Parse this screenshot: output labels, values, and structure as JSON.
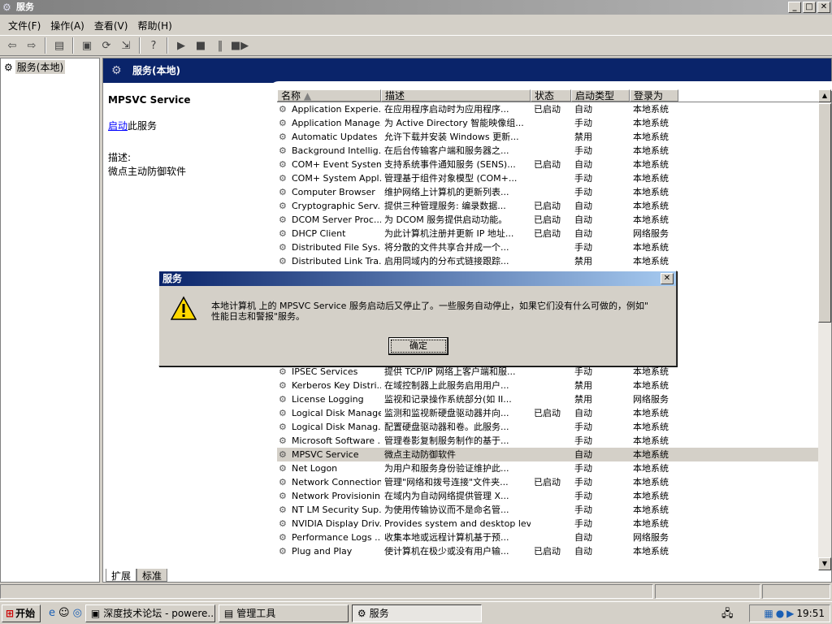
{
  "window": {
    "title": "服务"
  },
  "menu": [
    "文件(F)",
    "操作(A)",
    "查看(V)",
    "帮助(H)"
  ],
  "tree": {
    "root": "服务(本地)"
  },
  "pane": {
    "header": "服务(本地)",
    "selected_service": "MPSVC Service",
    "action_link": "启动",
    "action_suffix": "此服务",
    "desc_label": "描述:",
    "desc_text": "微点主动防御软件"
  },
  "columns": [
    "名称",
    "描述",
    "状态",
    "启动类型",
    "登录为"
  ],
  "rows_top": [
    [
      "Application Experie...",
      "在应用程序启动时为应用程序...",
      "已启动",
      "自动",
      "本地系统"
    ],
    [
      "Application Manage...",
      "为 Active Directory 智能映像组...",
      "",
      "手动",
      "本地系统"
    ],
    [
      "Automatic Updates",
      "允许下载并安装 Windows 更新...",
      "",
      "禁用",
      "本地系统"
    ],
    [
      "Background Intellig...",
      "在后台传输客户端和服务器之...",
      "",
      "手动",
      "本地系统"
    ],
    [
      "COM+ Event System",
      "支持系统事件通知服务 (SENS)...",
      "已启动",
      "自动",
      "本地系统"
    ],
    [
      "COM+ System Appl...",
      "管理基于组件对象模型 (COM+...",
      "",
      "手动",
      "本地系统"
    ],
    [
      "Computer Browser",
      "维护网络上计算机的更新列表...",
      "",
      "手动",
      "本地系统"
    ],
    [
      "Cryptographic Serv...",
      "提供三种管理服务: 编录数据...",
      "已启动",
      "自动",
      "本地系统"
    ],
    [
      "DCOM Server Proc...",
      "为 DCOM 服务提供启动功能。",
      "已启动",
      "自动",
      "本地系统"
    ],
    [
      "DHCP Client",
      "为此计算机注册并更新 IP 地址...",
      "已启动",
      "自动",
      "网络服务"
    ],
    [
      "Distributed File Sys...",
      "将分散的文件共享合并成一个...",
      "",
      "手动",
      "本地系统"
    ],
    [
      "Distributed Link Tra...",
      "启用同域内的分布式链接跟踪...",
      "",
      "禁用",
      "本地系统"
    ]
  ],
  "rows_bottom": [
    [
      "Intersite Messaging",
      "启用在运行 Windows Server 的...",
      "",
      "禁用",
      "本地系统"
    ],
    [
      "IPSEC Services",
      "提供 TCP/IP 网络上客户端和服...",
      "",
      "手动",
      "本地系统"
    ],
    [
      "Kerberos Key Distri...",
      "在域控制器上此服务启用用户...",
      "",
      "禁用",
      "本地系统"
    ],
    [
      "License Logging",
      "监视和记录操作系统部分(如 II...",
      "",
      "禁用",
      "网络服务"
    ],
    [
      "Logical Disk Manager",
      "监测和监视新硬盘驱动器并向...",
      "已启动",
      "自动",
      "本地系统"
    ],
    [
      "Logical Disk Manag...",
      "配置硬盘驱动器和卷。此服务...",
      "",
      "手动",
      "本地系统"
    ],
    [
      "Microsoft Software ...",
      "管理卷影复制服务制作的基于...",
      "",
      "手动",
      "本地系统"
    ],
    [
      "MPSVC Service",
      "微点主动防御软件",
      "",
      "自动",
      "本地系统"
    ],
    [
      "Net Logon",
      "为用户和服务身份验证维护此...",
      "",
      "手动",
      "本地系统"
    ],
    [
      "Network Connections",
      "管理\"网络和拨号连接\"文件夹...",
      "已启动",
      "手动",
      "本地系统"
    ],
    [
      "Network Provisionin...",
      "在域内为自动网络提供管理 X...",
      "",
      "手动",
      "本地系统"
    ],
    [
      "NT LM Security Sup...",
      "为使用传输协议而不是命名管...",
      "",
      "手动",
      "本地系统"
    ],
    [
      "NVIDIA Display Driv...",
      "Provides system and desktop lev...",
      "",
      "手动",
      "本地系统"
    ],
    [
      "Performance Logs ...",
      "收集本地或远程计算机基于预...",
      "",
      "自动",
      "网络服务"
    ],
    [
      "Plug and Play",
      "使计算机在极少或没有用户输...",
      "已启动",
      "自动",
      "本地系统"
    ]
  ],
  "tabs": [
    "扩展",
    "标准"
  ],
  "dialog": {
    "title": "服务",
    "message_line1": "本地计算机 上的 MPSVC Service 服务启动后又停止了。一些服务自动停止，如果它们没有什么可做的，例如\"",
    "message_line2": "性能日志和警报\"服务。",
    "ok": "确定"
  },
  "taskbar": {
    "start": "开始",
    "tasks": [
      "深度技术论坛 - powere...",
      "管理工具",
      "服务"
    ],
    "clock": "19:51"
  }
}
